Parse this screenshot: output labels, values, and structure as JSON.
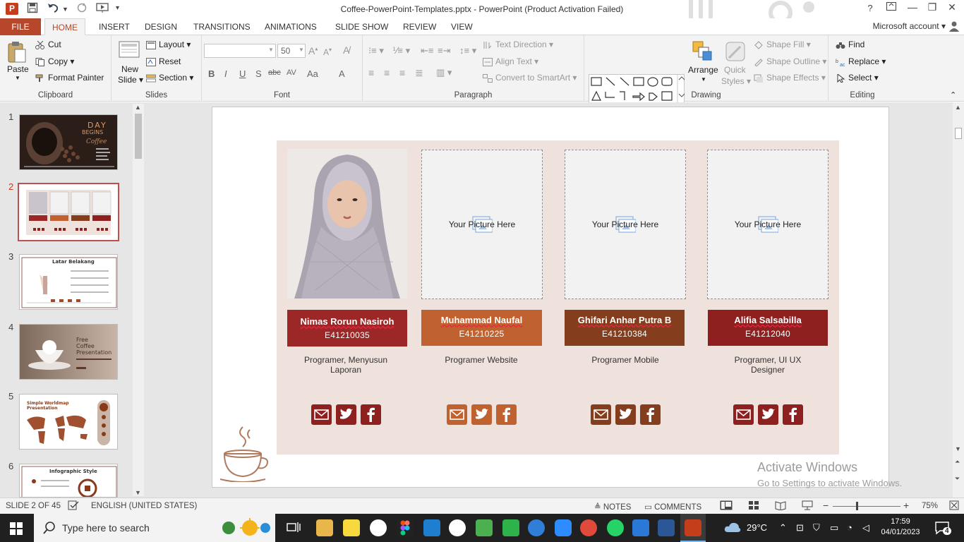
{
  "window": {
    "title": "Coffee-PowerPoint-Templates.pptx - PowerPoint (Product Activation Failed)",
    "help": "?"
  },
  "tabs": {
    "file": "FILE",
    "items": [
      "HOME",
      "INSERT",
      "DESIGN",
      "TRANSITIONS",
      "ANIMATIONS",
      "SLIDE SHOW",
      "REVIEW",
      "VIEW"
    ],
    "account": "Microsoft account"
  },
  "ribbon": {
    "clipboard": {
      "label": "Clipboard",
      "paste": "Paste",
      "cut": "Cut",
      "copy": "Copy",
      "format_painter": "Format Painter"
    },
    "slides": {
      "label": "Slides",
      "new_slide_1": "New",
      "new_slide_2": "Slide",
      "layout": "Layout",
      "reset": "Reset",
      "section": "Section"
    },
    "font": {
      "label": "Font",
      "font_name": "",
      "font_size": "50",
      "bold": "B",
      "italic": "I",
      "underline": "U",
      "shadow": "S",
      "strike": "abc",
      "spacing": "AV",
      "case": "Aa",
      "color": "A"
    },
    "paragraph": {
      "label": "Paragraph",
      "text_direction": "Text Direction",
      "align_text": "Align Text",
      "convert_smartart": "Convert to SmartArt"
    },
    "drawing": {
      "label": "Drawing",
      "arrange": "Arrange",
      "quick_styles_1": "Quick",
      "quick_styles_2": "Styles",
      "shape_fill": "Shape Fill",
      "shape_outline": "Shape Outline",
      "shape_effects": "Shape Effects"
    },
    "editing": {
      "label": "Editing",
      "find": "Find",
      "replace": "Replace",
      "select": "Select"
    }
  },
  "thumbnails": [
    {
      "num": "1",
      "title_1": "DAY",
      "title_2": "BEGINS",
      "title_3": "Coffee"
    },
    {
      "num": "2"
    },
    {
      "num": "3",
      "title": "Latar Belakang"
    },
    {
      "num": "4",
      "title_1": "Free",
      "title_2": "Coffee",
      "title_3": "Presentation"
    },
    {
      "num": "5",
      "title_1": "Simple Worldmap",
      "title_2": "Presentation"
    },
    {
      "num": "6",
      "title": "Infographic Style"
    }
  ],
  "slide": {
    "placeholder_text": "Your Picture Here",
    "members": [
      {
        "name": "Nimas Rorun Nasiroh",
        "id": "E41210035",
        "role_1": "Programer, Menyusun",
        "role_2": "Laporan",
        "color": "#9b2727"
      },
      {
        "name": "Muhammad Naufal",
        "id": "E41210225",
        "role_1": "Programer Website",
        "role_2": "",
        "color": "#c0622f"
      },
      {
        "name": "Ghifari Anhar Putra B",
        "id": "E41210384",
        "role_1": "Programer Mobile",
        "role_2": "",
        "color": "#843e1e"
      },
      {
        "name": "Alifia Salsabilla",
        "id": "E41212040",
        "role_1": "Programer, UI UX",
        "role_2": "Designer",
        "color": "#8f2020"
      }
    ],
    "social_icons": [
      "mail-icon",
      "twitter-icon",
      "facebook-icon"
    ]
  },
  "watermark": {
    "line1": "Activate Windows",
    "line2": "Go to Settings to activate Windows."
  },
  "status": {
    "slide_of": "SLIDE 2 OF 45",
    "language": "ENGLISH (UNITED STATES)",
    "notes": "NOTES",
    "comments": "COMMENTS",
    "zoom": "75%"
  },
  "taskbar": {
    "search_placeholder": "Type here to search",
    "temperature": "29°C",
    "time": "17:59",
    "date": "04/01/2023",
    "notifications": "4"
  },
  "colors": {
    "accent": "#b7472a",
    "slide_bg": "#efe1dc"
  }
}
